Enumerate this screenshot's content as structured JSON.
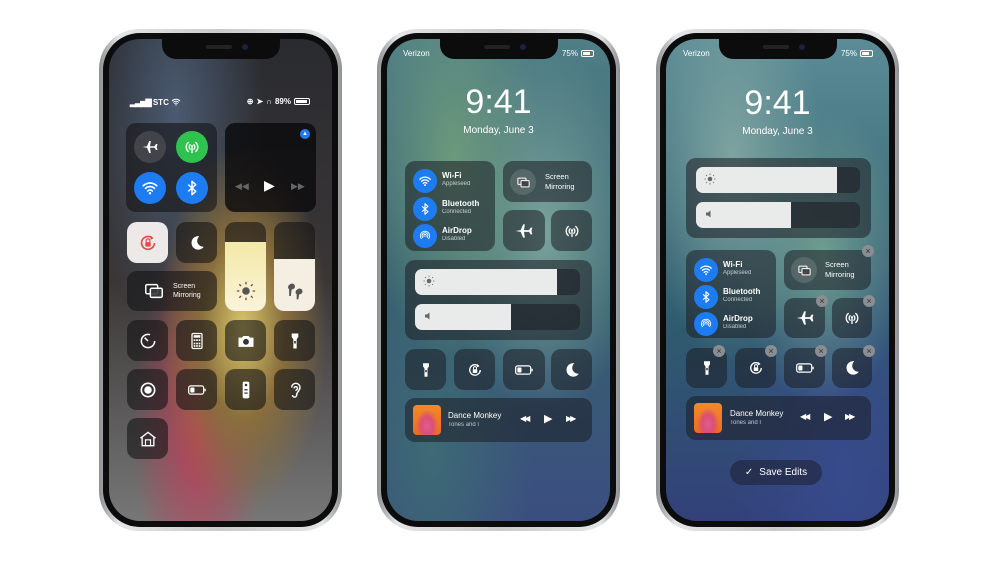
{
  "phones": [
    {
      "status": {
        "carrier": "STC",
        "battery": "89%"
      },
      "tiles": {
        "screen_mirroring": {
          "line1": "Screen",
          "line2": "Mirroring"
        }
      },
      "sliders": {
        "brightness_level": 0.77,
        "volume_level": 0.58
      }
    },
    {
      "status": {
        "carrier": "Verizon",
        "battery": "75%"
      },
      "time": "9:41",
      "date": "Monday, June 3",
      "connectivity": [
        {
          "label": "Wi-Fi",
          "sub": "Appleseed"
        },
        {
          "label": "Bluetooth",
          "sub": "Connected"
        },
        {
          "label": "AirDrop",
          "sub": "Disabled"
        }
      ],
      "screen_mirroring": {
        "line1": "Screen",
        "line2": "Mirroring"
      },
      "sliders": {
        "brightness_level": 0.86,
        "volume_level": 0.58
      },
      "media": {
        "title": "Dance Monkey",
        "artist": "Tones and I"
      }
    },
    {
      "status": {
        "carrier": "Verizon",
        "battery": "75%"
      },
      "time": "9:41",
      "date": "Monday, June 3",
      "connectivity": [
        {
          "label": "Wi-Fi",
          "sub": "Appleseed"
        },
        {
          "label": "Bluetooth",
          "sub": "Connected"
        },
        {
          "label": "AirDrop",
          "sub": "Disabled"
        }
      ],
      "screen_mirroring": {
        "line1": "Screen",
        "line2": "Mirroring"
      },
      "sliders": {
        "brightness_level": 0.86,
        "volume_level": 0.58
      },
      "media": {
        "title": "Dance Monkey",
        "artist": "Tones and I"
      },
      "save_label": "Save Edits",
      "remove_glyph": "×"
    }
  ],
  "colors": {
    "accent_blue": "#1e7cf2",
    "cellular_green": "#30c24f",
    "rotation_lock_red": "#e5484d"
  }
}
